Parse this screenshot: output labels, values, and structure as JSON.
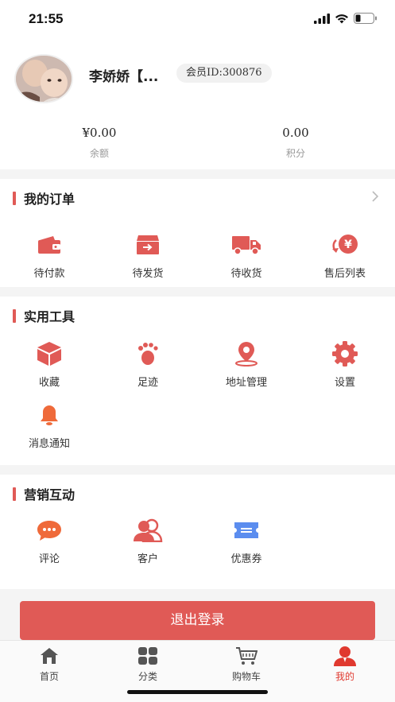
{
  "status": {
    "time": "21:55"
  },
  "profile": {
    "name": "李娇娇【...",
    "member_id": "会员ID:300876",
    "balance_value": "¥0.00",
    "balance_label": "余额",
    "points_value": "0.00",
    "points_label": "积分"
  },
  "orders": {
    "title": "我的订单",
    "items": [
      {
        "label": "待付款",
        "icon": "wallet-icon"
      },
      {
        "label": "待发货",
        "icon": "box-icon"
      },
      {
        "label": "待收货",
        "icon": "truck-icon"
      },
      {
        "label": "售后列表",
        "icon": "refund-icon"
      }
    ]
  },
  "tools": {
    "title": "实用工具",
    "items": [
      {
        "label": "收藏",
        "icon": "cube-icon"
      },
      {
        "label": "足迹",
        "icon": "footprint-icon"
      },
      {
        "label": "地址管理",
        "icon": "location-icon"
      },
      {
        "label": "设置",
        "icon": "gear-icon"
      },
      {
        "label": "消息通知",
        "icon": "bell-icon"
      }
    ]
  },
  "marketing": {
    "title": "营销互动",
    "items": [
      {
        "label": "评论",
        "icon": "comment-icon"
      },
      {
        "label": "客户",
        "icon": "customers-icon"
      },
      {
        "label": "优惠券",
        "icon": "coupon-icon"
      }
    ]
  },
  "logout_label": "退出登录",
  "tabbar": {
    "items": [
      {
        "label": "首页",
        "icon": "home-icon"
      },
      {
        "label": "分类",
        "icon": "grid-icon"
      },
      {
        "label": "购物车",
        "icon": "cart-icon"
      },
      {
        "label": "我的",
        "icon": "user-icon",
        "active": true
      }
    ]
  },
  "colors": {
    "accent": "#e05a56",
    "active_tab": "#e0392f",
    "coupon": "#5b8def",
    "bell": "#ef6a3a"
  }
}
